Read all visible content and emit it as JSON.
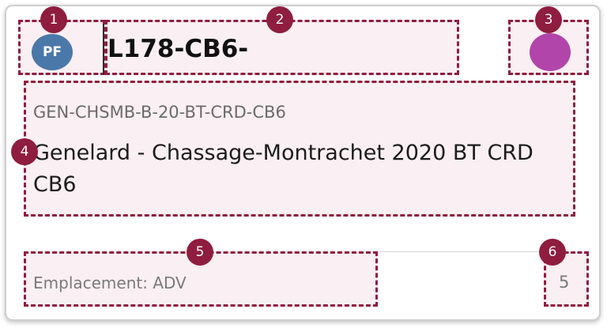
{
  "card": {
    "badge": "PF",
    "title": "L178-CB6-",
    "code": "GEN-CHSMB-B-20-BT-CRD-CB6",
    "description": "Genelard - Chassage-Montrachet 2020 BT CRD CB6",
    "location": "Emplacement: ADV",
    "quantity": "5",
    "status_color": "#b245a9",
    "badge_color": "#4a78a9"
  },
  "markers": [
    "1",
    "2",
    "3",
    "4",
    "5",
    "6"
  ],
  "accent_color": "#8f1d3f"
}
